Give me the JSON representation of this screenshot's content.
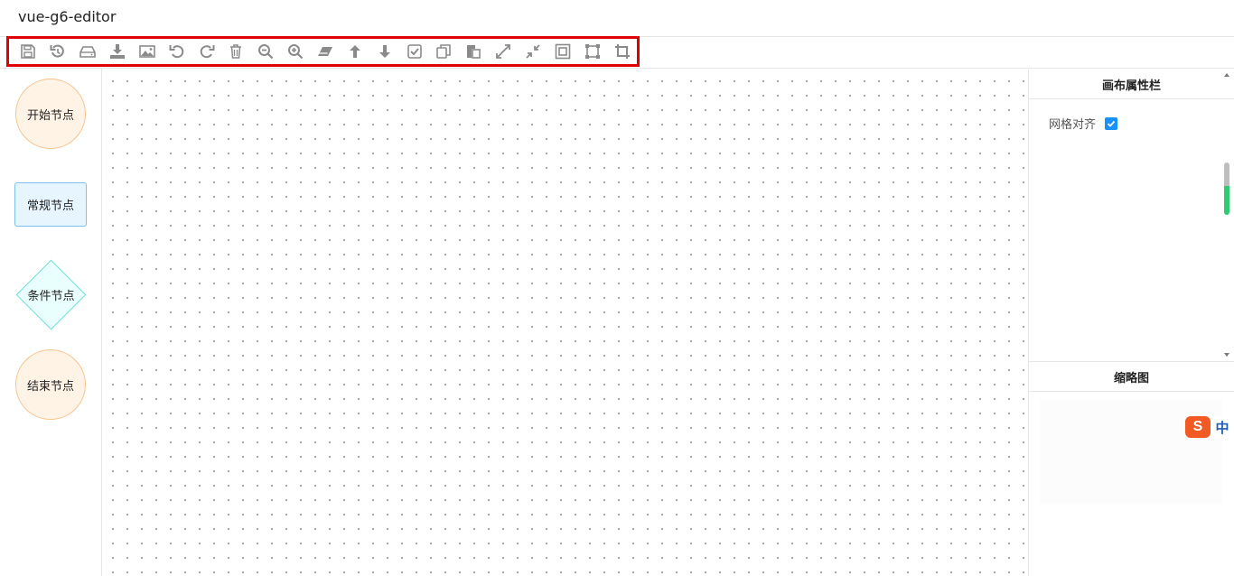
{
  "app": {
    "title": "vue-g6-editor"
  },
  "toolbar": {
    "icons": [
      "save-icon",
      "history-icon",
      "drive-icon",
      "download-icon",
      "image-icon",
      "undo-icon",
      "redo-icon",
      "delete-icon",
      "zoom-out-icon",
      "zoom-in-icon",
      "eraser-icon",
      "arrow-up-icon",
      "arrow-down-icon",
      "select-all-icon",
      "copy-icon",
      "paste-icon",
      "expand-icon",
      "compress-icon",
      "fit-view-icon",
      "actual-size-icon",
      "crop-icon"
    ],
    "highlight_color": "#e00000",
    "icon_color": "#8a8a8a"
  },
  "item_panel": {
    "start_node": "开始节点",
    "normal_node": "常规节点",
    "condition_node": "条件节点",
    "end_node": "结束节点"
  },
  "detail_panel": {
    "title": "画布属性栏",
    "grid_align_label": "网格对齐",
    "grid_align_checked": true
  },
  "minimap": {
    "title": "缩略图"
  },
  "ime": {
    "logo": "S",
    "mode": "中"
  },
  "colors": {
    "accent": "#1890ff",
    "start_fill": "#fff3e6",
    "normal_fill": "#e6f5ff",
    "condition_fill": "#e8fffd"
  }
}
